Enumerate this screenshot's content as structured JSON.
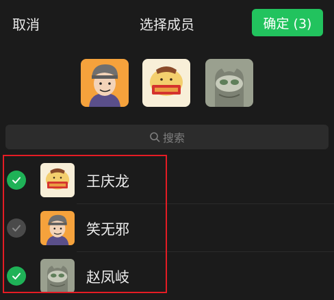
{
  "header": {
    "cancel_label": "取消",
    "title": "选择成员",
    "confirm_label": "确定 (3)"
  },
  "selected_avatars": [
    {
      "icon": "avatar-cartoon-boy"
    },
    {
      "icon": "avatar-pompompurin"
    },
    {
      "icon": "avatar-cat"
    }
  ],
  "search": {
    "placeholder": "搜索"
  },
  "contacts": [
    {
      "name": "王庆龙",
      "checked": true,
      "icon": "avatar-pompompurin"
    },
    {
      "name": "笑无邪",
      "checked": true,
      "disabled": true,
      "icon": "avatar-cartoon-boy"
    },
    {
      "name": "赵凤岐",
      "checked": true,
      "icon": "avatar-cat"
    }
  ],
  "colors": {
    "accent": "#22c35e",
    "check_on": "#1fb257",
    "check_disabled": "#4a4a4a",
    "highlight": "#e51c24",
    "background": "#1b1b1b"
  }
}
